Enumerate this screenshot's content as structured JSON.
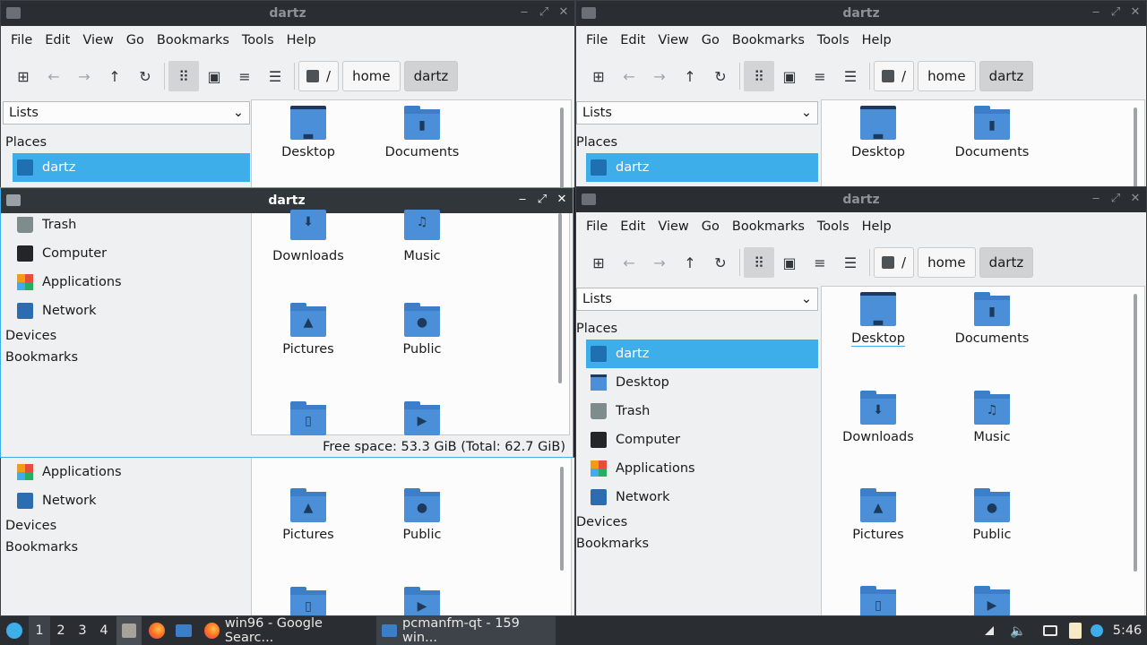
{
  "window_title": "dartz",
  "menu": [
    "File",
    "Edit",
    "View",
    "Go",
    "Bookmarks",
    "Tools",
    "Help"
  ],
  "path": {
    "root": "/",
    "home": "home",
    "current": "dartz"
  },
  "side_pane": {
    "mode": "Lists",
    "places_header": "Places",
    "devices_header": "Devices",
    "bookmarks_header": "Bookmarks"
  },
  "places": [
    "dartz",
    "Desktop",
    "Trash",
    "Computer",
    "Applications",
    "Network"
  ],
  "files": [
    "Desktop",
    "Documents",
    "Downloads",
    "Music",
    "Pictures",
    "Public"
  ],
  "status": {
    "free_space": "Free space: 53.3 GiB (Total: 62.7 GiB)"
  },
  "taskbar": {
    "desktops": [
      "1",
      "2",
      "3",
      "4"
    ],
    "tasks": [
      "win96 - Google Searc...",
      "pcmanfm-qt - 159 win..."
    ],
    "clock": "5:46"
  },
  "colors": {
    "accent": "#3daee9",
    "folder": "#4a8fd8",
    "titlebar": "#31363b",
    "panel": "#2a2e32"
  }
}
